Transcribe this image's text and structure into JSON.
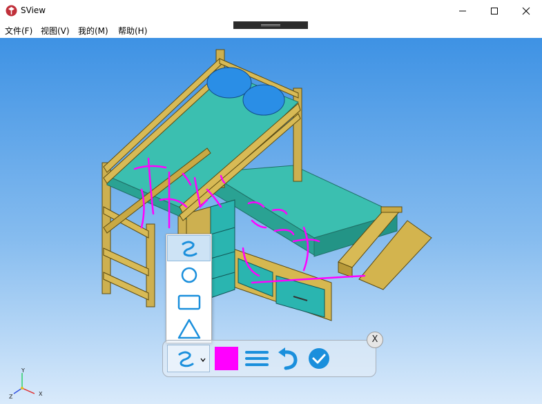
{
  "window": {
    "title": "SView",
    "icons": {
      "app": "sview-logo-icon",
      "minimize": "minimize-icon",
      "maximize": "maximize-icon",
      "close": "close-icon"
    }
  },
  "menu": [
    {
      "label": "文件(F)"
    },
    {
      "label": "视图(V)"
    },
    {
      "label": "我的(M)"
    },
    {
      "label": "帮助(H)"
    }
  ],
  "viewport": {
    "content": "3d-bunk-bed-model",
    "annotation_color": "#ff00ff",
    "background_top": "#3e92e4",
    "background_bottom": "#d9eafb"
  },
  "shape_menu": {
    "items": [
      {
        "name": "freehand",
        "icon": "freehand-icon",
        "selected": true
      },
      {
        "name": "circle",
        "icon": "circle-icon",
        "selected": false
      },
      {
        "name": "rectangle",
        "icon": "rectangle-icon",
        "selected": false
      },
      {
        "name": "triangle",
        "icon": "triangle-icon",
        "selected": false
      }
    ]
  },
  "toolbar": {
    "close_label": "X",
    "current_shape_icon": "freehand-icon",
    "color": "#ff00ff",
    "line_width_icon": "line-width-icon",
    "undo_icon": "undo-icon",
    "confirm_icon": "check-icon"
  },
  "axis": {
    "y": "Y",
    "z": "Z",
    "x": "X"
  }
}
